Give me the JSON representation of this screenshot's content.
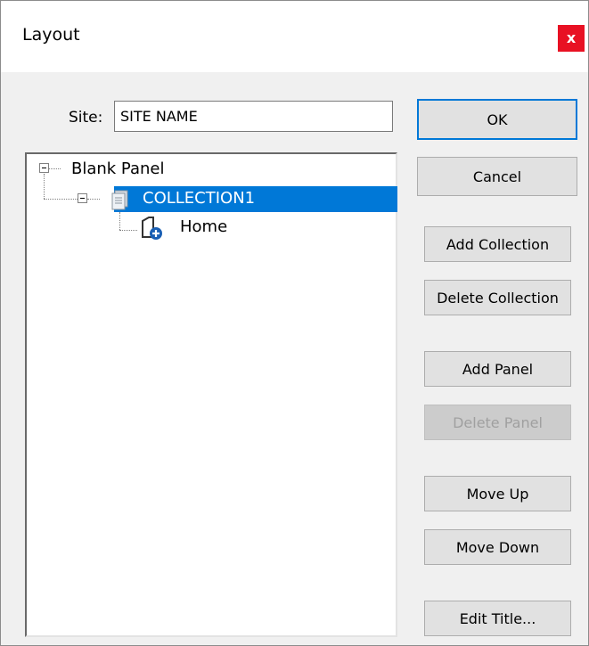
{
  "window": {
    "title": "Layout",
    "close_label": "x"
  },
  "site": {
    "label": "Site:",
    "value": "SITE NAME"
  },
  "tree": {
    "root": "Blank Panel",
    "collection": "COLLECTION1",
    "panel": "Home"
  },
  "buttons": {
    "ok": "OK",
    "cancel": "Cancel",
    "add_collection": "Add Collection",
    "delete_collection": "Delete Collection",
    "add_panel": "Add Panel",
    "delete_panel": "Delete Panel",
    "move_up": "Move Up",
    "move_down": "Move Down",
    "edit_title": "Edit Title..."
  },
  "colors": {
    "selection": "#0078d7",
    "close": "#e81123",
    "disabled_text": "#a0a0a0"
  }
}
